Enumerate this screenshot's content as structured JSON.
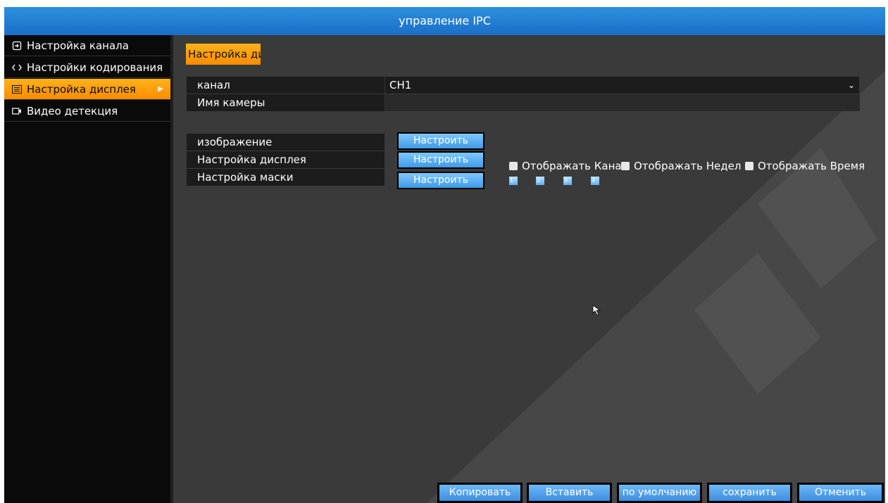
{
  "window": {
    "title": "управление IPC"
  },
  "sidebar": {
    "items": [
      {
        "label": "Настройка канала",
        "icon": "channel-input-icon"
      },
      {
        "label": "Настройки кодирования",
        "icon": "code-icon"
      },
      {
        "label": "Настройка дисплея",
        "icon": "display-list-icon",
        "active": true
      },
      {
        "label": "Видео детекция",
        "icon": "video-camera-icon"
      }
    ]
  },
  "main": {
    "tab_label": "Настройка ди",
    "channel": {
      "label": "канал",
      "value": "CH1"
    },
    "camera_name": {
      "label": "Имя камеры",
      "value": ""
    },
    "settings": [
      {
        "label": "изображение",
        "button": "Настроить"
      },
      {
        "label": "Настройка дисплея",
        "button": "Настроить"
      },
      {
        "label": "Настройка маски",
        "button": "Настроить"
      }
    ],
    "display_checks": [
      {
        "label": "Отображать Кана",
        "checked": false
      },
      {
        "label": "Отображать Недел",
        "checked": false
      },
      {
        "label": "Отображать Время",
        "checked": false
      }
    ],
    "mask_areas": [
      "1",
      "2",
      "3",
      "4"
    ]
  },
  "footer": {
    "copy": "Копировать",
    "paste": "Вставить",
    "default": "по умолчанию",
    "save": "сохранить",
    "cancel": "Отменить"
  },
  "colors": {
    "accent_orange": "#ff9a00",
    "title_blue": "#1f7ad0",
    "button_blue": "#4fa6ee",
    "panel_bg": "#3a3a3b"
  }
}
